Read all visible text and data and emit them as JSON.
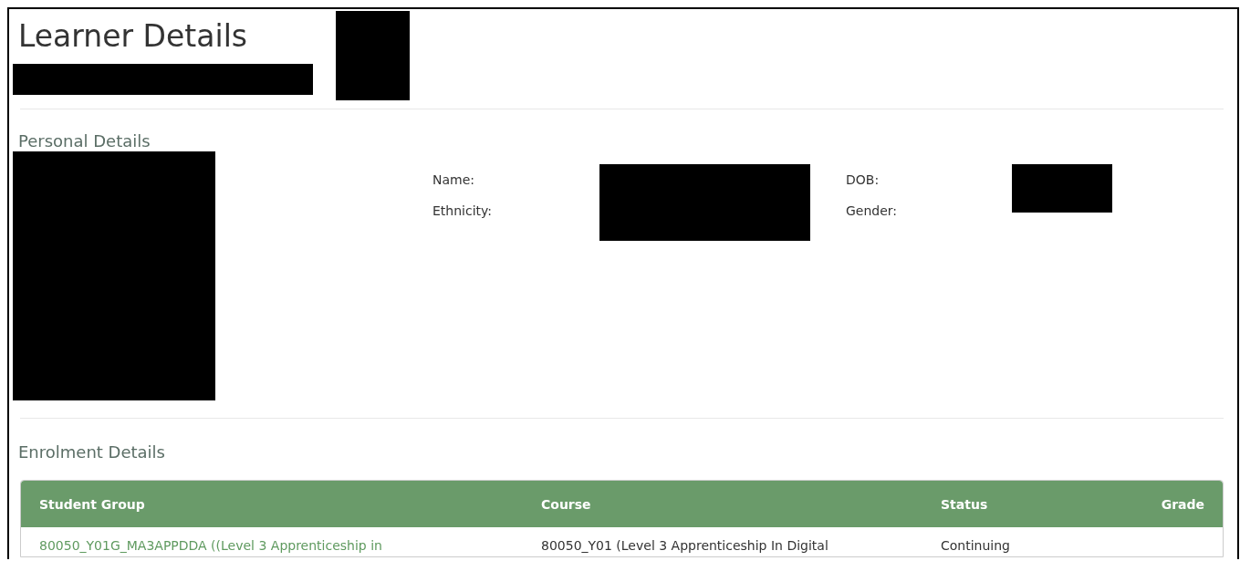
{
  "page_title": "Learner Details",
  "personal_details": {
    "heading": "Personal Details",
    "fields": [
      {
        "label": "Name:"
      },
      {
        "label": "DOB:"
      },
      {
        "label": "Ethnicity:"
      },
      {
        "label": "Gender:"
      }
    ]
  },
  "enrolment_details": {
    "heading": "Enrolment Details",
    "table": {
      "columns": [
        "Student Group",
        "Course",
        "Status",
        "Grade"
      ],
      "rows": [
        {
          "student_group": "80050_Y01G_MA3APPDDA ((Level 3 Apprenticeship in",
          "course": "80050_Y01 (Level 3 Apprenticeship In Digital",
          "status": "Continuing"
        }
      ]
    }
  }
}
